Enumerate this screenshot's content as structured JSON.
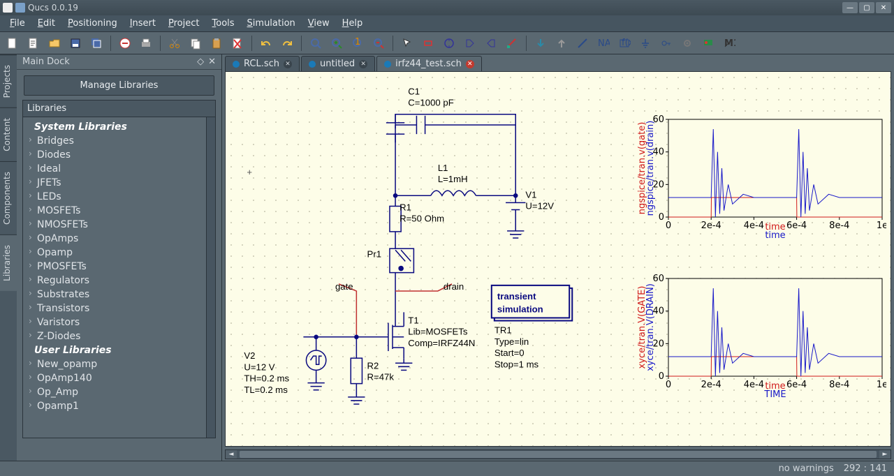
{
  "window": {
    "title": "Qucs 0.0.19"
  },
  "menu": [
    "File",
    "Edit",
    "Positioning",
    "Insert",
    "Project",
    "Tools",
    "Simulation",
    "View",
    "Help"
  ],
  "toolbar_icons": [
    "new-file",
    "new-text",
    "open",
    "save",
    "save-all",
    "",
    "delete",
    "print",
    "",
    "cut",
    "copy",
    "paste",
    "remove",
    "",
    "undo",
    "redo",
    "",
    "zoom-fit",
    "zoom-in",
    "zoom-1",
    "zoom-out",
    "",
    "select",
    "resistor",
    "ground-rot",
    "port",
    "port2",
    "wire",
    "",
    "arrow-down",
    "arrow-up",
    "line",
    "name",
    "sim-box",
    "gnd",
    "key",
    "gear",
    "flag",
    "marker"
  ],
  "dock": {
    "title": "Main Dock",
    "side_tabs": [
      "Projects",
      "Content",
      "Components",
      "Libraries"
    ],
    "active_side_tab": "Libraries",
    "manage_btn": "Manage Libraries",
    "list_title": "Libraries",
    "items": [
      {
        "label": "System Libraries",
        "hdr": true
      },
      {
        "label": "Bridges"
      },
      {
        "label": "Diodes"
      },
      {
        "label": "Ideal"
      },
      {
        "label": "JFETs"
      },
      {
        "label": "LEDs"
      },
      {
        "label": "MOSFETs"
      },
      {
        "label": "NMOSFETs"
      },
      {
        "label": "OpAmps"
      },
      {
        "label": "Opamp"
      },
      {
        "label": "PMOSFETs"
      },
      {
        "label": "Regulators"
      },
      {
        "label": "Substrates"
      },
      {
        "label": "Transistors"
      },
      {
        "label": "Varistors"
      },
      {
        "label": "Z-Diodes"
      },
      {
        "label": "User Libraries",
        "hdr": true
      },
      {
        "label": "New_opamp"
      },
      {
        "label": "OpAmp140"
      },
      {
        "label": "Op_Amp"
      },
      {
        "label": "Opamp1"
      }
    ]
  },
  "tabs": [
    {
      "label": "RCL.sch",
      "active": false,
      "closeable": true
    },
    {
      "label": "untitled",
      "active": false,
      "closeable": true
    },
    {
      "label": "irfz44_test.sch",
      "active": true,
      "closeable": true,
      "dirty": true
    }
  ],
  "schematic": {
    "components": {
      "C1": {
        "name": "C1",
        "val": "C=1000 pF"
      },
      "L1": {
        "name": "L1",
        "val": "L=1mH"
      },
      "R1": {
        "name": "R1",
        "val": "R=50 Ohm"
      },
      "V1": {
        "name": "V1",
        "val": "U=12V"
      },
      "Pr1": {
        "name": "Pr1"
      },
      "T1": {
        "name": "T1",
        "val1": "Lib=MOSFETs",
        "val2": "Comp=IRFZ44N"
      },
      "R2": {
        "name": "R2",
        "val": "R=47k"
      },
      "V2": {
        "name": "V2",
        "val1": "U=12 V",
        "val2": "TH=0.2 ms",
        "val3": "TL=0.2 ms"
      },
      "labels": {
        "gate": "gate",
        "drain": "drain"
      }
    },
    "simblock": {
      "title1": "transient",
      "title2": "simulation",
      "p1": "TR1",
      "p2": "Type=lin",
      "p3": "Start=0",
      "p4": "Stop=1 ms"
    }
  },
  "chart_data": [
    {
      "type": "line",
      "title": "",
      "xlabel_1": "time",
      "xlabel_2": "time",
      "ylabel_1": "ngspice/tran.v(gate)",
      "ylabel_2": "ngspice/tran.v(drain)",
      "xlim": [
        0,
        0.001
      ],
      "ylim": [
        0,
        60
      ],
      "xticks": [
        "0",
        "2e-4",
        "4e-4",
        "6e-4",
        "8e-4",
        "1e"
      ],
      "yticks": [
        0,
        20,
        40,
        60
      ],
      "series": [
        {
          "name": "ngspice/tran.v(gate)",
          "color": "#d01818",
          "x": [
            0,
            0.0002,
            0.000201,
            0.0004,
            0.0006,
            0.000601,
            0.0008,
            0.001
          ],
          "y": [
            0,
            0,
            12,
            12,
            12,
            0,
            0,
            0
          ]
        },
        {
          "name": "ngspice/tran.v(drain)",
          "color": "#1818c8",
          "x": [
            0,
            0.0002,
            0.00021,
            0.00022,
            0.00023,
            0.00024,
            0.00025,
            0.00026,
            0.00028,
            0.0003,
            0.00035,
            0.0004,
            0.0006,
            0.00061,
            0.00062,
            0.00063,
            0.00064,
            0.00065,
            0.00066,
            0.00068,
            0.0007,
            0.00075,
            0.0008,
            0.001
          ],
          "y": [
            12,
            12,
            54,
            0,
            40,
            2,
            30,
            4,
            20,
            8,
            14,
            12,
            12,
            54,
            0,
            40,
            2,
            30,
            4,
            20,
            8,
            14,
            12,
            12
          ]
        }
      ]
    },
    {
      "type": "line",
      "title": "",
      "xlabel_1": "TIME",
      "xlabel_2": "time",
      "ylabel_1": "xyce/tran.V(GATE)",
      "ylabel_2": "xyce/tran.V(DRAIN)",
      "xlim": [
        0,
        0.001
      ],
      "ylim": [
        0,
        60
      ],
      "xticks": [
        "0",
        "2e-4",
        "4e-4",
        "6e-4",
        "8e-4",
        "1e"
      ],
      "yticks": [
        0,
        20,
        40,
        60
      ],
      "series": [
        {
          "name": "xyce/tran.V(GATE)",
          "color": "#d01818",
          "x": [
            0,
            0.0002,
            0.000201,
            0.0004,
            0.0006,
            0.000601,
            0.0008,
            0.001
          ],
          "y": [
            0,
            0,
            12,
            12,
            12,
            0,
            0,
            0
          ]
        },
        {
          "name": "xyce/tran.V(DRAIN)",
          "color": "#1818c8",
          "x": [
            0,
            0.0002,
            0.00021,
            0.00022,
            0.00023,
            0.00024,
            0.00025,
            0.00026,
            0.00028,
            0.0003,
            0.00035,
            0.0004,
            0.0006,
            0.00061,
            0.00062,
            0.00063,
            0.00064,
            0.00065,
            0.00066,
            0.00068,
            0.0007,
            0.00075,
            0.0008,
            0.001
          ],
          "y": [
            12,
            12,
            54,
            0,
            40,
            2,
            30,
            4,
            20,
            8,
            14,
            12,
            12,
            54,
            0,
            40,
            2,
            30,
            4,
            20,
            8,
            14,
            12,
            12
          ]
        }
      ]
    }
  ],
  "status": {
    "warnings": "no warnings",
    "coords": "292 : 141"
  }
}
